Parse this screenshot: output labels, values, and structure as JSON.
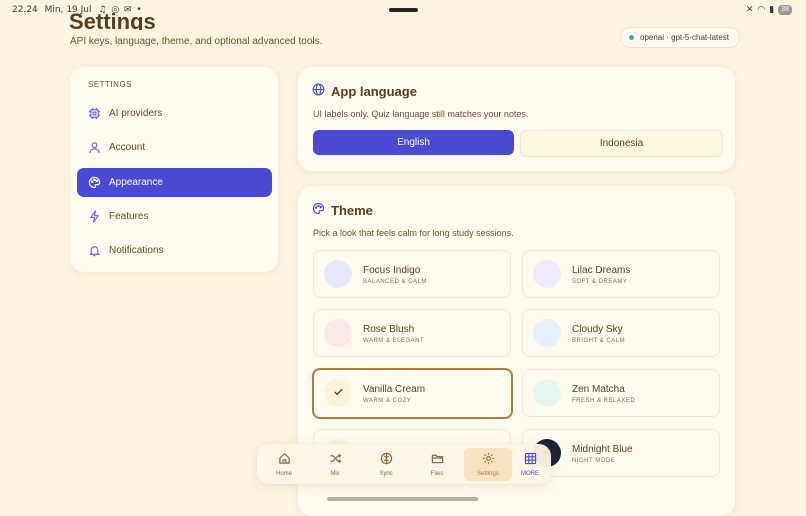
{
  "status": {
    "time": "22.24",
    "date": "Min, 19 Jul",
    "battery": "38"
  },
  "header": {
    "title": "Settings",
    "subtitle": "API keys, language, theme, and optional advanced tools.",
    "model_chip": "openai · gpt-5-chat-latest"
  },
  "sidebar": {
    "heading": "SETTINGS",
    "items": [
      {
        "label": "AI providers",
        "icon": "chip-icon"
      },
      {
        "label": "Account",
        "icon": "user-icon"
      },
      {
        "label": "Appearance",
        "icon": "palette-icon",
        "active": true
      },
      {
        "label": "Features",
        "icon": "lightning-icon"
      },
      {
        "label": "Notifications",
        "icon": "bell-icon"
      }
    ]
  },
  "language": {
    "title": "App language",
    "subtitle": "UI labels only. Quiz language still matches your notes.",
    "options": [
      "English",
      "Indonesia"
    ],
    "selected": "English"
  },
  "theme": {
    "title": "Theme",
    "subtitle": "Pick a look that feels calm for long study sessions.",
    "options": [
      {
        "name": "Focus Indigo",
        "desc": "BALANCED & CALM",
        "swatch": "#e6e8fb"
      },
      {
        "name": "Lilac Dreams",
        "desc": "SOFT & DREAMY",
        "swatch": "#efeafb"
      },
      {
        "name": "Rose Blush",
        "desc": "WARM & ELEGANT",
        "swatch": "#fbe9ea"
      },
      {
        "name": "Cloudy Sky",
        "desc": "BRIGHT & CALM",
        "swatch": "#e6f0fb"
      },
      {
        "name": "Vanilla Cream",
        "desc": "WARM & COZY",
        "swatch": "#fbf3dd",
        "selected": true
      },
      {
        "name": "Zen Matcha",
        "desc": "FRESH & RELAXED",
        "swatch": "#e6f6ee"
      },
      {
        "name": "",
        "desc": "",
        "swatch": "#fbf3dd"
      },
      {
        "name": "Midnight Blue",
        "desc": "NIGHT MODE",
        "swatch": "#1d2233"
      }
    ]
  },
  "bottom_nav": {
    "items": [
      {
        "label": "Home",
        "icon": "home-icon"
      },
      {
        "label": "Mix",
        "icon": "shuffle-icon"
      },
      {
        "label": "Sync",
        "icon": "sync-icon"
      },
      {
        "label": "Files",
        "icon": "folder-icon"
      },
      {
        "label": "Settings",
        "icon": "gear-icon",
        "active": true
      },
      {
        "label": "MORE",
        "icon": "grid-icon"
      }
    ]
  },
  "colors": {
    "accent": "#4a49d3",
    "background": "#fcf4e0",
    "selected_border": "#b07b3e"
  }
}
